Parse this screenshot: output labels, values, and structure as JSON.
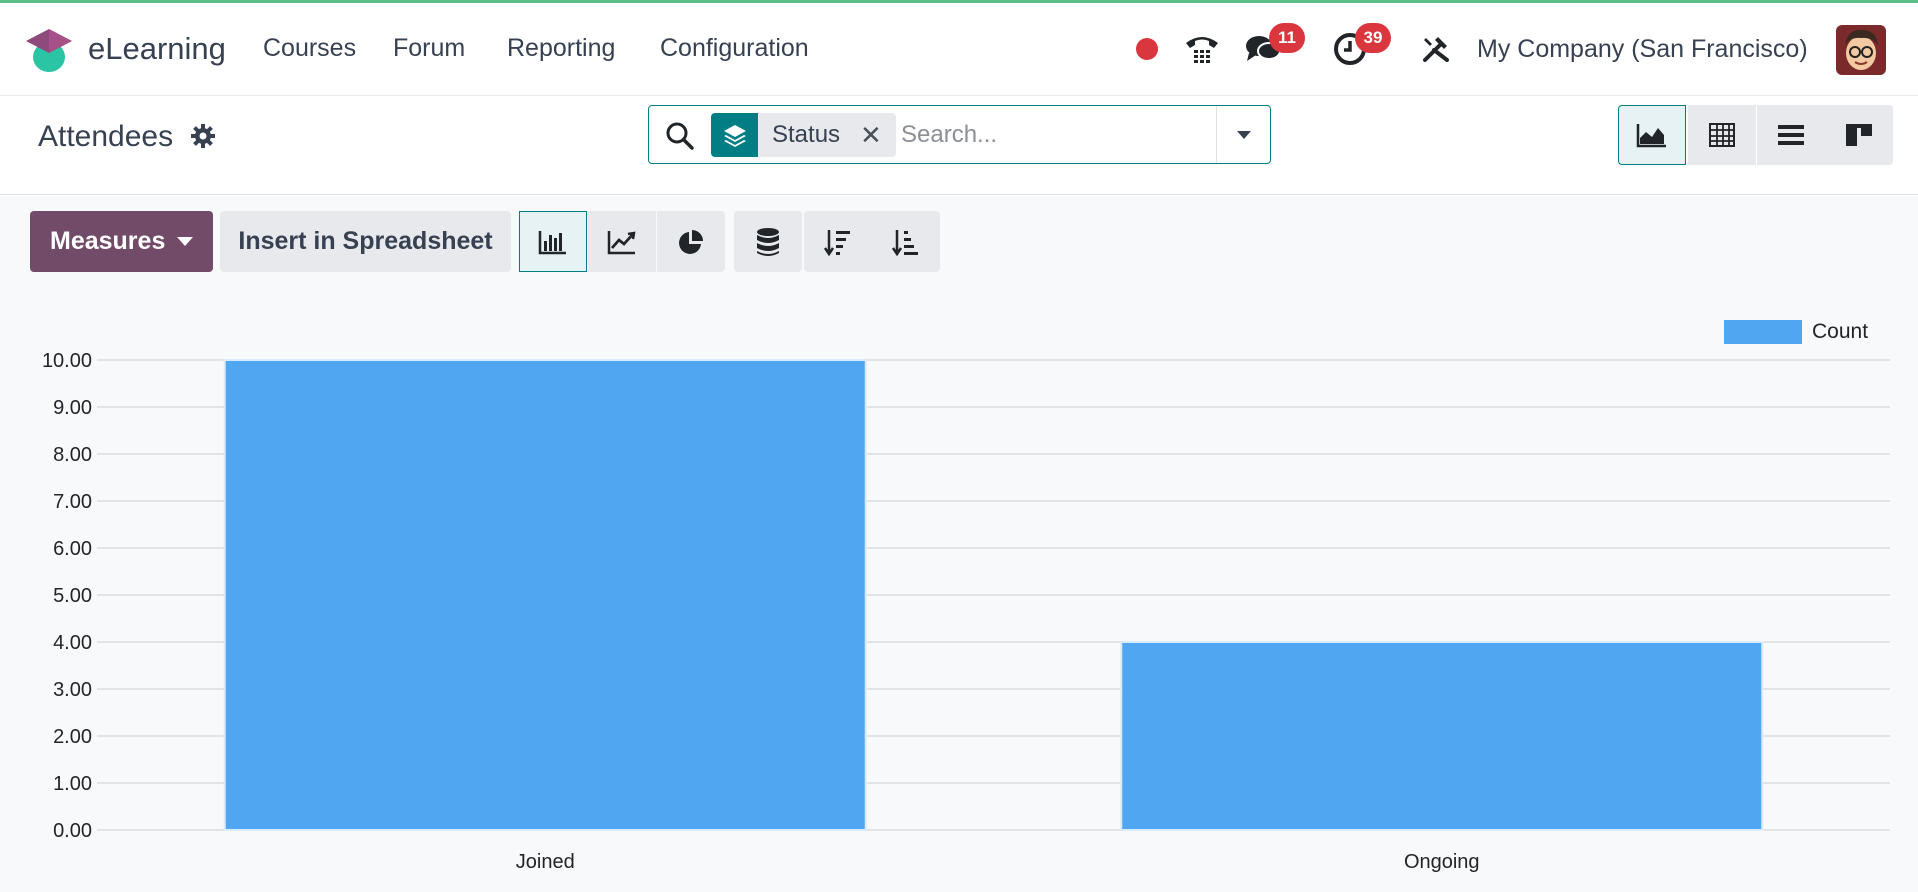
{
  "app": {
    "name": "eLearning"
  },
  "menu": [
    "Courses",
    "Forum",
    "Reporting",
    "Configuration"
  ],
  "systray": {
    "messages_badge": "11",
    "activities_badge": "39",
    "company": "My Company (San Francisco)"
  },
  "control_panel": {
    "breadcrumb": "Attendees",
    "search": {
      "facet_label": "Status",
      "placeholder": "Search..."
    }
  },
  "toolbar": {
    "measures_label": "Measures",
    "spreadsheet_label": "Insert in Spreadsheet"
  },
  "colors": {
    "brand": "#714b67",
    "accent": "#017e84",
    "bar": "#4fa7f2",
    "badge": "#d9363e",
    "record": "#d9363e"
  },
  "chart_data": {
    "type": "bar",
    "categories": [
      "Joined",
      "Ongoing"
    ],
    "series": [
      {
        "name": "Count",
        "values": [
          10,
          4
        ]
      }
    ],
    "ylim": [
      0,
      10
    ],
    "yticks": [
      "0.00",
      "1.00",
      "2.00",
      "3.00",
      "4.00",
      "5.00",
      "6.00",
      "7.00",
      "8.00",
      "9.00",
      "10.00"
    ],
    "grid": true,
    "legend_position": "top-right"
  }
}
